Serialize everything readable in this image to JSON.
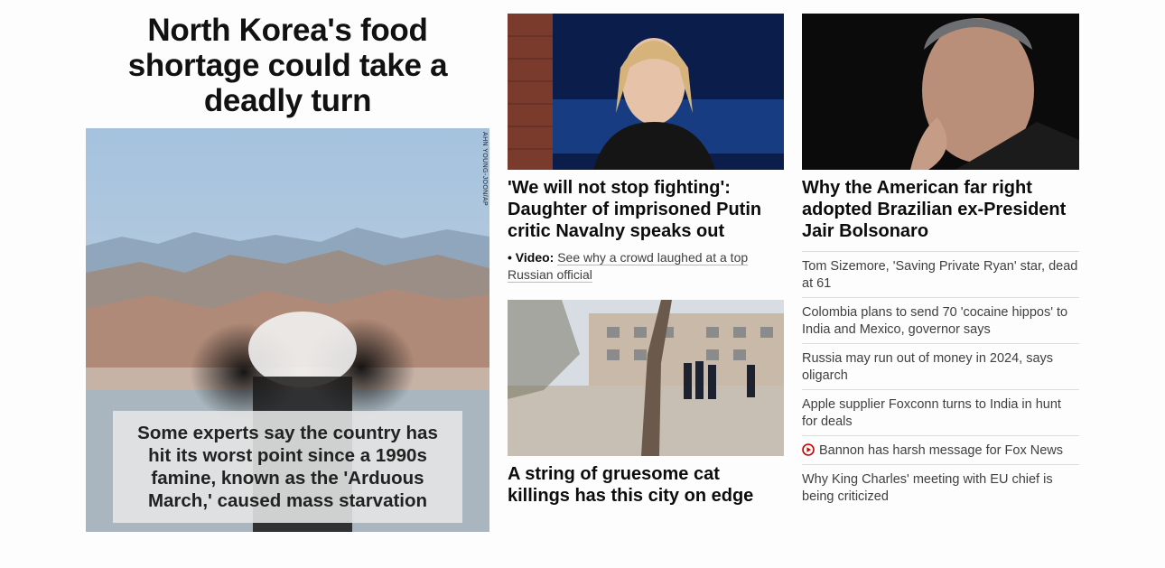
{
  "lead": {
    "headline": "North Korea's food shortage could take a deadly turn",
    "photo_credit": "AHN YOUNG-JOON/AP",
    "caption": "Some experts say the country has hit its worst point since a 1990s famine, known as the 'Arduous March,' caused mass starvation"
  },
  "middle": {
    "story1": {
      "headline": "'We will not stop fighting': Daughter of imprisoned Putin critic Navalny speaks out",
      "video_prefix": "• Video:",
      "video_text": "See why a crowd laughed at a top Russian official"
    },
    "story2": {
      "headline": "A string of gruesome cat killings has this city on edge"
    }
  },
  "right": {
    "headline": "Why the American far right adopted Brazilian ex-President Jair Bolsonaro",
    "list": [
      "Tom Sizemore, 'Saving Private Ryan' star, dead at 61",
      "Colombia plans to send 70 'cocaine hippos' to India and Mexico, governor says",
      "Russia may run out of money in 2024, says oligarch",
      "Apple supplier Foxconn turns to India in hunt for deals",
      "Bannon has harsh message for Fox News",
      "Why King Charles' meeting with EU chief is being criticized"
    ]
  },
  "colors": {
    "video_icon": "#cc0000",
    "divider": "#dddddd",
    "caption_bg": "#e6e6e6"
  }
}
